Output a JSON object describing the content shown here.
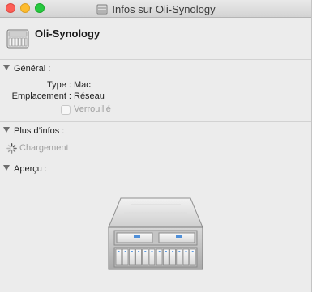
{
  "window": {
    "title": "Infos sur Oli-Synology",
    "buttons": [
      "close",
      "minimize",
      "zoom"
    ]
  },
  "header": {
    "name": "Oli-Synology",
    "icon": "server-icon"
  },
  "general": {
    "heading": "Général :",
    "type_label": "Type :",
    "type_value": "Mac",
    "location_label": "Emplacement :",
    "location_value": "Réseau",
    "locked_label": "Verrouillé",
    "locked_checked": false,
    "locked_enabled": false
  },
  "more_info": {
    "heading": "Plus d’infos :",
    "loading_text": "Chargement…"
  },
  "preview": {
    "heading": "Aperçu :",
    "icon": "server-rack-icon"
  }
}
